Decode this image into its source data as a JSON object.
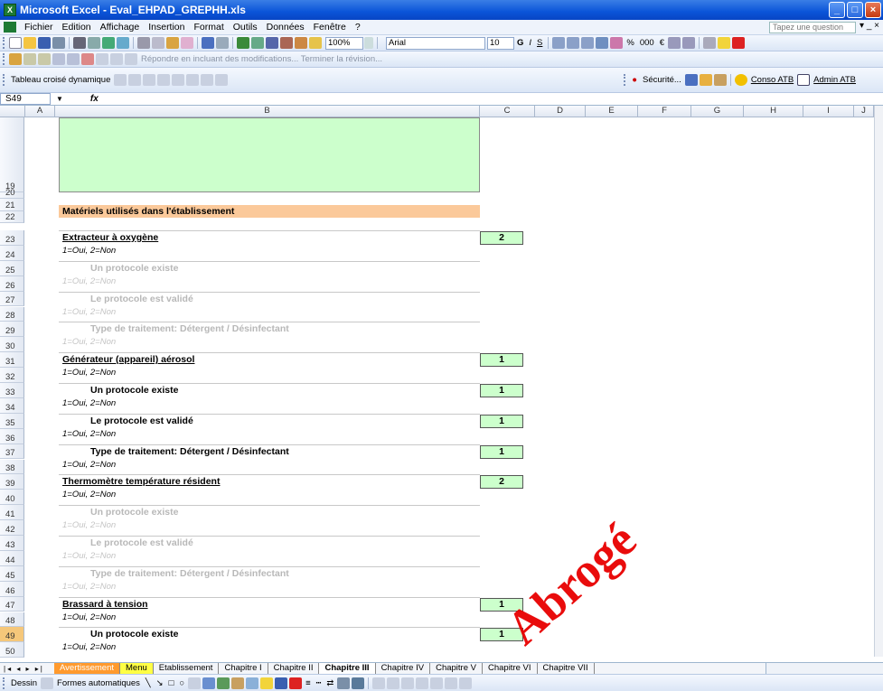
{
  "window": {
    "title": "Microsoft Excel - Eval_EHPAD_GREPHH.xls"
  },
  "menu": {
    "items": [
      "Fichier",
      "Edition",
      "Affichage",
      "Insertion",
      "Format",
      "Outils",
      "Données",
      "Fenêtre",
      "?"
    ],
    "ask_placeholder": "Tapez une question"
  },
  "toolbar": {
    "zoom": "100%",
    "font": "Arial",
    "font_size": "10",
    "reviewing_text": "Répondre en incluant des modifications... Terminer la révision...",
    "pivot_label": "Tableau croisé dynamique",
    "security_label": "Sécurité...",
    "conso_label": "Conso ATB",
    "admin_label": "Admin ATB"
  },
  "formula_bar": {
    "cell_ref": "S49",
    "fx": "fx"
  },
  "columns": [
    "A",
    "B",
    "C",
    "D",
    "E",
    "F",
    "G",
    "H",
    "I",
    "J"
  ],
  "rows": [
    "19",
    "20",
    "21",
    "22",
    "23",
    "24",
    "25",
    "26",
    "27",
    "28",
    "29",
    "30",
    "31",
    "32",
    "33",
    "34",
    "35",
    "36",
    "37",
    "38",
    "39",
    "40",
    "41",
    "42",
    "43",
    "44",
    "45",
    "46",
    "47",
    "48",
    "49",
    "50"
  ],
  "selected_row": "49",
  "section": {
    "title": "Matériels utilisés dans l'établissement"
  },
  "hint_text": "1=Oui, 2=Non",
  "items": [
    {
      "label": "Extracteur à oxygène",
      "type": "main",
      "dim": false,
      "value": "2"
    },
    {
      "label": "Un protocole existe",
      "type": "sub",
      "dim": true,
      "value": ""
    },
    {
      "label": "Le protocole est validé",
      "type": "sub",
      "dim": true,
      "value": ""
    },
    {
      "label": "Type de traitement: Détergent / Désinfectant",
      "type": "sub",
      "dim": true,
      "value": ""
    },
    {
      "label": "Générateur (appareil) aérosol",
      "type": "main",
      "dim": false,
      "value": "1"
    },
    {
      "label": "Un protocole existe",
      "type": "sub",
      "dim": false,
      "value": "1"
    },
    {
      "label": "Le protocole est validé",
      "type": "sub",
      "dim": false,
      "value": "1"
    },
    {
      "label": "Type de traitement: Détergent / Désinfectant",
      "type": "sub",
      "dim": false,
      "value": "1"
    },
    {
      "label": "Thermomètre température résident",
      "type": "main",
      "dim": false,
      "value": "2"
    },
    {
      "label": "Un protocole existe",
      "type": "sub",
      "dim": true,
      "value": ""
    },
    {
      "label": "Le protocole est validé",
      "type": "sub",
      "dim": true,
      "value": ""
    },
    {
      "label": "Type de traitement: Détergent / Désinfectant",
      "type": "sub",
      "dim": true,
      "value": ""
    },
    {
      "label": "Brassard à tension",
      "type": "main",
      "dim": false,
      "value": "1"
    },
    {
      "label": "Un protocole existe",
      "type": "sub",
      "dim": false,
      "value": "1"
    }
  ],
  "sheet_tabs": [
    {
      "label": "Avertissement",
      "style": "orange"
    },
    {
      "label": "Menu",
      "style": "yellow"
    },
    {
      "label": "Etablissement",
      "style": "normal"
    },
    {
      "label": "Chapitre I",
      "style": "normal"
    },
    {
      "label": "Chapitre II",
      "style": "normal"
    },
    {
      "label": "Chapitre III",
      "style": "active"
    },
    {
      "label": "Chapitre IV",
      "style": "normal"
    },
    {
      "label": "Chapitre V",
      "style": "normal"
    },
    {
      "label": "Chapitre VI",
      "style": "normal"
    },
    {
      "label": "Chapitre VII",
      "style": "normal"
    }
  ],
  "drawbar": {
    "draw_label": "Dessin",
    "autoshapes_label": "Formes automatiques"
  },
  "watermark": "Abrogé",
  "colors": {
    "titlebar": "#0a54d8",
    "green_cell": "#ccffcc",
    "section_orange": "#fbc99a",
    "watermark_red": "#e80000"
  }
}
